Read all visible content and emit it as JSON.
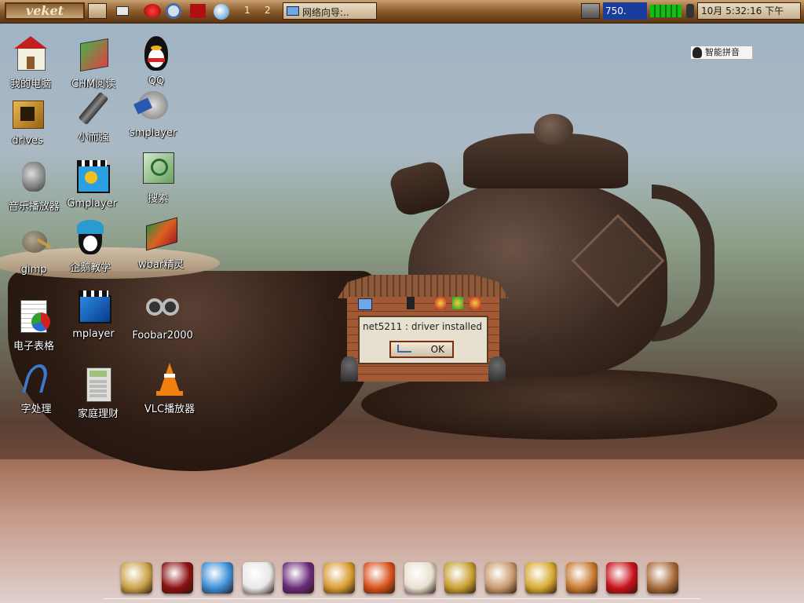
{
  "panel": {
    "logo": "veket",
    "workspaces": [
      "1",
      "2"
    ],
    "task_title": "网络向导:..",
    "meter_value": "750.",
    "clock": "10月  5:32:16 下午"
  },
  "ime": {
    "label": "智能拼音"
  },
  "desktop_icons": [
    {
      "label": "我的电脑",
      "icon": "computer-icon"
    },
    {
      "label": "CHM阅读",
      "icon": "chm-reader-icon"
    },
    {
      "label": "QQ",
      "icon": "qq-penguin-icon"
    },
    {
      "label": "drives",
      "icon": "drives-icon"
    },
    {
      "label": "小而强",
      "icon": "usb-stick-icon"
    },
    {
      "label": "smplayer",
      "icon": "smplayer-icon"
    },
    {
      "label": "音乐播放器",
      "icon": "speaker-icon"
    },
    {
      "label": "Gmplayer",
      "icon": "gmplayer-icon"
    },
    {
      "label": "搜索",
      "icon": "search-icon"
    },
    {
      "label": "gimp",
      "icon": "gimp-icon"
    },
    {
      "label": "企鹅教学",
      "icon": "penguin-tutorial-icon"
    },
    {
      "label": "wbar精灵",
      "icon": "wbar-icon"
    },
    {
      "label": "电子表格",
      "icon": "spreadsheet-icon"
    },
    {
      "label": "mplayer",
      "icon": "mplayer-icon"
    },
    {
      "label": "Foobar2000",
      "icon": "foobar-icon"
    },
    {
      "label": "字处理",
      "icon": "word-processor-icon"
    },
    {
      "label": "家庭理财",
      "icon": "calculator-icon"
    },
    {
      "label": "VLC播放器",
      "icon": "vlc-cone-icon"
    }
  ],
  "dialog": {
    "message": "net5211 : driver installed",
    "ok_label": "OK"
  },
  "dock_items": [
    {
      "icon": "pavilion-icon",
      "color": "#c9a24a"
    },
    {
      "icon": "red-book-icon",
      "color": "#8a1010"
    },
    {
      "icon": "globe-icon",
      "color": "#3b8ed6"
    },
    {
      "icon": "notepad-icon",
      "color": "#e8e8e8"
    },
    {
      "icon": "media-disc-icon",
      "color": "#6a2a7a"
    },
    {
      "icon": "taiji-icon",
      "color": "#d89a30"
    },
    {
      "icon": "fire-icon",
      "color": "#d8501a"
    },
    {
      "icon": "document-icon",
      "color": "#e8e0d0"
    },
    {
      "icon": "abacus-icon",
      "color": "#c8a030"
    },
    {
      "icon": "picture-frame-icon",
      "color": "#c89a6a"
    },
    {
      "icon": "treasure-box-icon",
      "color": "#d8a830"
    },
    {
      "icon": "bowl-icon",
      "color": "#c87a30"
    },
    {
      "icon": "chinese-knot-icon",
      "color": "#c8101a"
    },
    {
      "icon": "ink-brush-icon",
      "color": "#a86a3a"
    }
  ]
}
